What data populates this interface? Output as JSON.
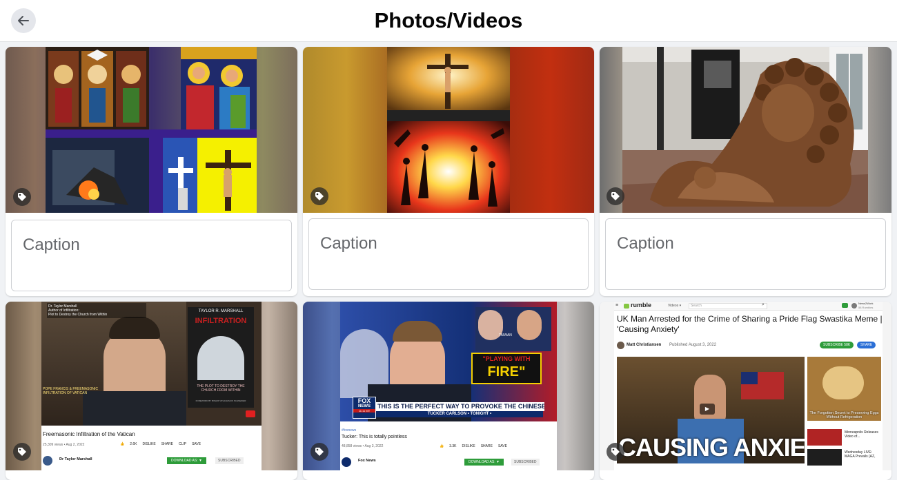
{
  "header": {
    "title": "Photos/Videos",
    "back_icon": "arrow-left-icon"
  },
  "caption_placeholder": "Caption",
  "items": [
    {
      "type": "photo",
      "subject": "collage",
      "caption_value": ""
    },
    {
      "type": "photo",
      "subject": "collage",
      "caption_value": ""
    },
    {
      "type": "photo",
      "subject": "lion statue",
      "caption_value": ""
    },
    {
      "type": "video-screenshot",
      "video_title": "Freemasonic Infiltration of the Vatican",
      "views_date": "25,309 views • Aug 2, 2022",
      "likes": "2.6K",
      "actions": [
        "DISLIKE",
        "SHARE",
        "CLIP",
        "SAVE"
      ],
      "channel": "Dr Taylor Marshall",
      "download_label": "DOWNLOAD AS: ▼",
      "subscribed_label": "SUBSCRIBED",
      "overlay_top_left": "Dr. Taylor Marshall\nAuthor of Infiltration:\nPlot to Destroy the Church from Within",
      "book_author": "TAYLOR R. MARSHALL",
      "book_title": "INFILTRATION",
      "book_subtitle": "THE PLOT TO DESTROY THE CHURCH FROM WITHIN",
      "book_foreword": "FOREWORD BY BISHOP ATHANASIUS SCHNEIDER",
      "lower_text": "POPE FRANCIS & FREEMASONIC INFILTRATION OF VATICAN"
    },
    {
      "type": "video-screenshot",
      "hashtag": "#foxnews",
      "video_title": "Tucker: This is totally pointless",
      "views_date": "48,858 views • Aug 3, 2022",
      "likes": "3.3K",
      "actions": [
        "DISLIKE",
        "SHARE",
        "SAVE"
      ],
      "channel": "Fox News",
      "download_label": "DOWNLOAD AS: ▼",
      "subscribed_label": "SUBSCRIBED",
      "chyron": "THIS IS THE PERFECT WAY TO PROVOKE THE CHINESE",
      "chyron_sub": "TUCKER CARLSON • TONIGHT •",
      "promo_top": "\"PLAYING WITH",
      "promo_bottom": "FIRE\"",
      "network_top": "FOX",
      "network_bottom": "NEWS",
      "clock": "11:11 MT",
      "map_label": "TAIWAN"
    },
    {
      "type": "web-screenshot",
      "site": "rumble",
      "nav_videos": "Videos ▾",
      "nav_search": "Search",
      "user_top": "News2Work",
      "user_sub": "58 Rumbles",
      "article_title": "UK Man Arrested for the Crime of Sharing a Pride Flag Swastika Meme | 'Causing Anxiety'",
      "author": "Matt Christiansen",
      "published": "Published August 3, 2022",
      "subscribe": "SUBSCRIBE 58K",
      "share": "SHARE",
      "thumb_text": "CAUSING ANXIETY",
      "side1": "The Forgotten Secret to Preserving Eggs Without Refrigeration",
      "side2_title": "Minneapolis Releases Video of...",
      "side3_title": "Wednesday LIVE: MAGA Prevails (AZ,"
    }
  ],
  "colors": {
    "header_bg": "#ffffff",
    "page_bg": "#f0f2f5",
    "rumble_green": "#85c742",
    "yt_green": "#2e9c3a"
  }
}
